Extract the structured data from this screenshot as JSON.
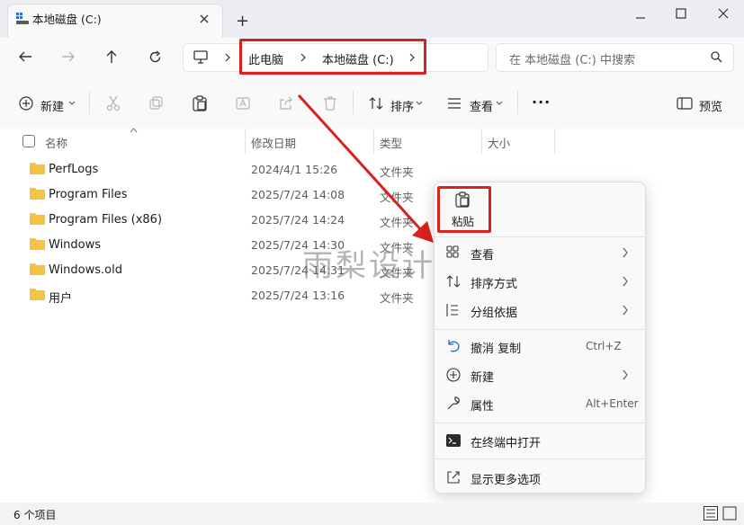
{
  "window": {
    "tab_title": "本地磁盘 (C:)",
    "new_tab_label": "+",
    "controls": [
      "minimize",
      "maximize",
      "close"
    ]
  },
  "breadcrumb": {
    "items": [
      "此电脑",
      "本地磁盘 (C:)"
    ]
  },
  "search": {
    "placeholder": "在 本地磁盘 (C:) 中搜索"
  },
  "toolbar": {
    "new_label": "新建",
    "sort_label": "排序",
    "view_label": "查看",
    "more_label": "···",
    "preview_label": "预览"
  },
  "columns": {
    "name": "名称",
    "date": "修改日期",
    "type": "类型",
    "size": "大小"
  },
  "files": [
    {
      "name": "PerfLogs",
      "date": "2024/4/1 15:26",
      "type": "文件夹"
    },
    {
      "name": "Program Files",
      "date": "2025/7/24 14:08",
      "type": "文件夹"
    },
    {
      "name": "Program Files (x86)",
      "date": "2025/7/24 14:24",
      "type": "文件夹"
    },
    {
      "name": "Windows",
      "date": "2025/7/24 14:30",
      "type": "文件夹"
    },
    {
      "name": "Windows.old",
      "date": "2025/7/24 14:31",
      "type": "文件夹"
    },
    {
      "name": "用户",
      "date": "2025/7/24 13:16",
      "type": "文件夹"
    }
  ],
  "context_menu": {
    "paste_label": "粘贴",
    "items": [
      {
        "label": "查看",
        "icon": "grid-icon",
        "submenu": true
      },
      {
        "label": "排序方式",
        "icon": "sort-icon",
        "submenu": true
      },
      {
        "label": "分组依据",
        "icon": "group-icon",
        "submenu": true
      },
      {
        "label": "撤消 复制",
        "icon": "undo-icon",
        "shortcut": "Ctrl+Z"
      },
      {
        "label": "新建",
        "icon": "plus-circle-icon",
        "submenu": true
      },
      {
        "label": "属性",
        "icon": "wrench-icon",
        "shortcut": "Alt+Enter"
      },
      {
        "label": "在终端中打开",
        "icon": "terminal-icon"
      },
      {
        "label": "显示更多选项",
        "icon": "share-icon"
      }
    ]
  },
  "status": {
    "count_text": "6 个项目"
  },
  "watermark": "雨梨设计",
  "colors": {
    "accent": "#0067c0",
    "highlight_red": "#d9211e",
    "folder": "#f5c242"
  }
}
